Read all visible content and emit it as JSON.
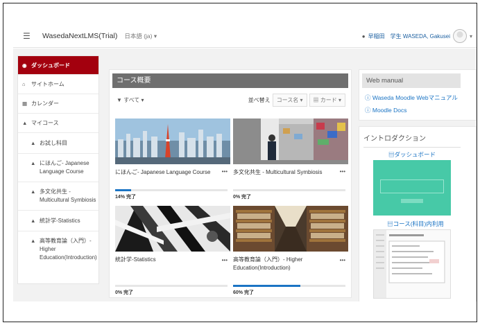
{
  "navbar": {
    "menu_icon": "hamburger-icon",
    "site_name": "WasedaNextLMS(Trial)",
    "language": "日本語 (ja) ▾",
    "message_icon": "chat-bubble-icon",
    "university": "早稲田",
    "user": "学生 WASEDA, Gakusei",
    "caret": "▾"
  },
  "drawer": {
    "items": [
      {
        "label": "ダッシュボード",
        "icon": "dashboard-icon"
      },
      {
        "label": "サイトホーム",
        "icon": "home-icon"
      },
      {
        "label": "カレンダー",
        "icon": "calendar-icon"
      },
      {
        "label": "マイコース",
        "icon": "graduation-cap-icon"
      },
      {
        "label": "お試し科目",
        "icon": "graduation-cap-icon"
      },
      {
        "label": "にほんご- Japanese Language Course",
        "icon": "graduation-cap-icon"
      },
      {
        "label": "多文化共生 - Multicultural Symbiosis",
        "icon": "graduation-cap-icon"
      },
      {
        "label": "統計学-Statistics",
        "icon": "graduation-cap-icon"
      },
      {
        "label": "高等教育論（入門）- Higher Education(Introduction)",
        "icon": "graduation-cap-icon"
      }
    ]
  },
  "main": {
    "header": "コース概要",
    "filter": "▼ すべて ▾",
    "sort_label": "並べ替え",
    "sort_value": "コース名 ▾",
    "view_value": "▦ カード ▾",
    "courses": [
      {
        "title": "にほんご- Japanese Language Course",
        "progress": 14,
        "progress_text": "14% 完了"
      },
      {
        "title": "多文化共生 - Multicultural Symbiosis",
        "progress": 0,
        "progress_text": "0% 完了"
      },
      {
        "title": "統計学-Statistics",
        "progress": 0,
        "progress_text": "0% 完了"
      },
      {
        "title": "高等教育論（入門）- Higher Education(Introduction)",
        "progress": 60,
        "progress_text": "60% 完了"
      }
    ],
    "more": "•••"
  },
  "web_manual": {
    "header": "Web manual",
    "links": [
      "ⓘ Waseda Moodle Webマニュアル",
      "ⓘ Moodle Docs"
    ]
  },
  "intro": {
    "header": "イントロダクション",
    "link1": "▤ダッシュボード",
    "link2": "▤コース(科目)内利用"
  },
  "colors": {
    "accent": "#a3000e",
    "link": "#1b74c4",
    "header_bar": "#6f6f6f",
    "card_green": "#47c9a7"
  }
}
